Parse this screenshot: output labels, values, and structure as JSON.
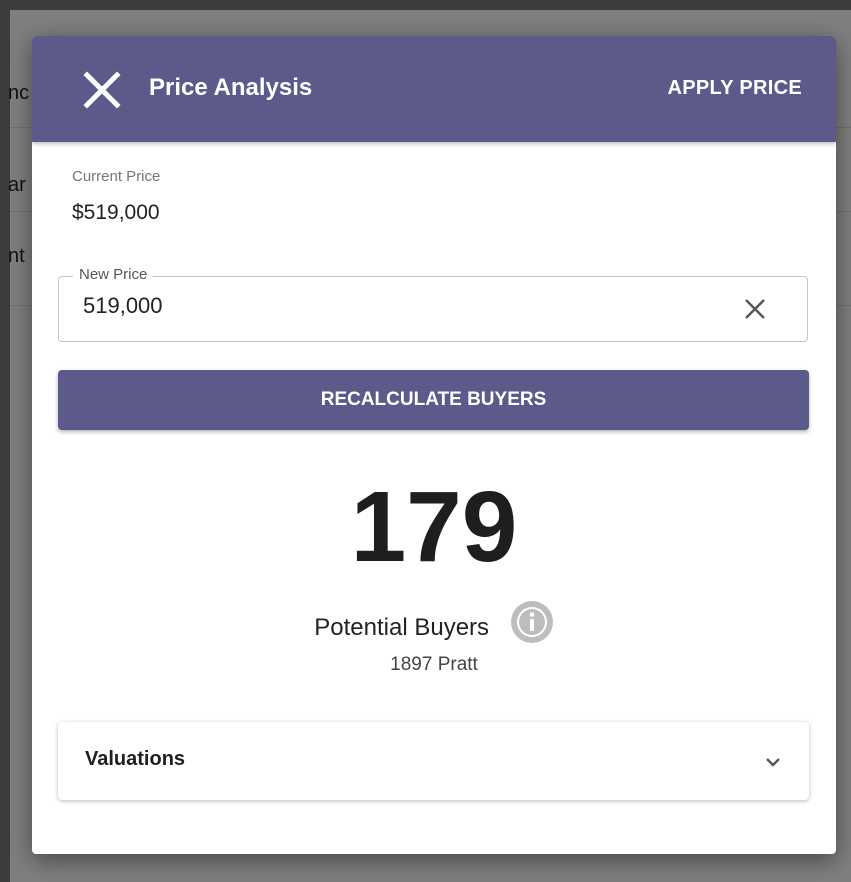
{
  "background": {
    "rows": [
      "nc",
      "ar",
      "nt"
    ]
  },
  "dialog": {
    "title": "Price Analysis",
    "apply_label": "APPLY PRICE",
    "close_icon": "close-icon",
    "header_color": "#5b5a8b"
  },
  "current_price": {
    "label": "Current Price",
    "value": "$519,000"
  },
  "new_price": {
    "label": "New Price",
    "value": "519,000",
    "clear_icon": "clear-icon"
  },
  "recalculate": {
    "label": "RECALCULATE BUYERS"
  },
  "buyers": {
    "count": "179",
    "label": "Potential Buyers",
    "info_icon": "info-icon",
    "address": "1897 Pratt"
  },
  "valuations": {
    "label": "Valuations",
    "expand_icon": "chevron-down-icon"
  }
}
